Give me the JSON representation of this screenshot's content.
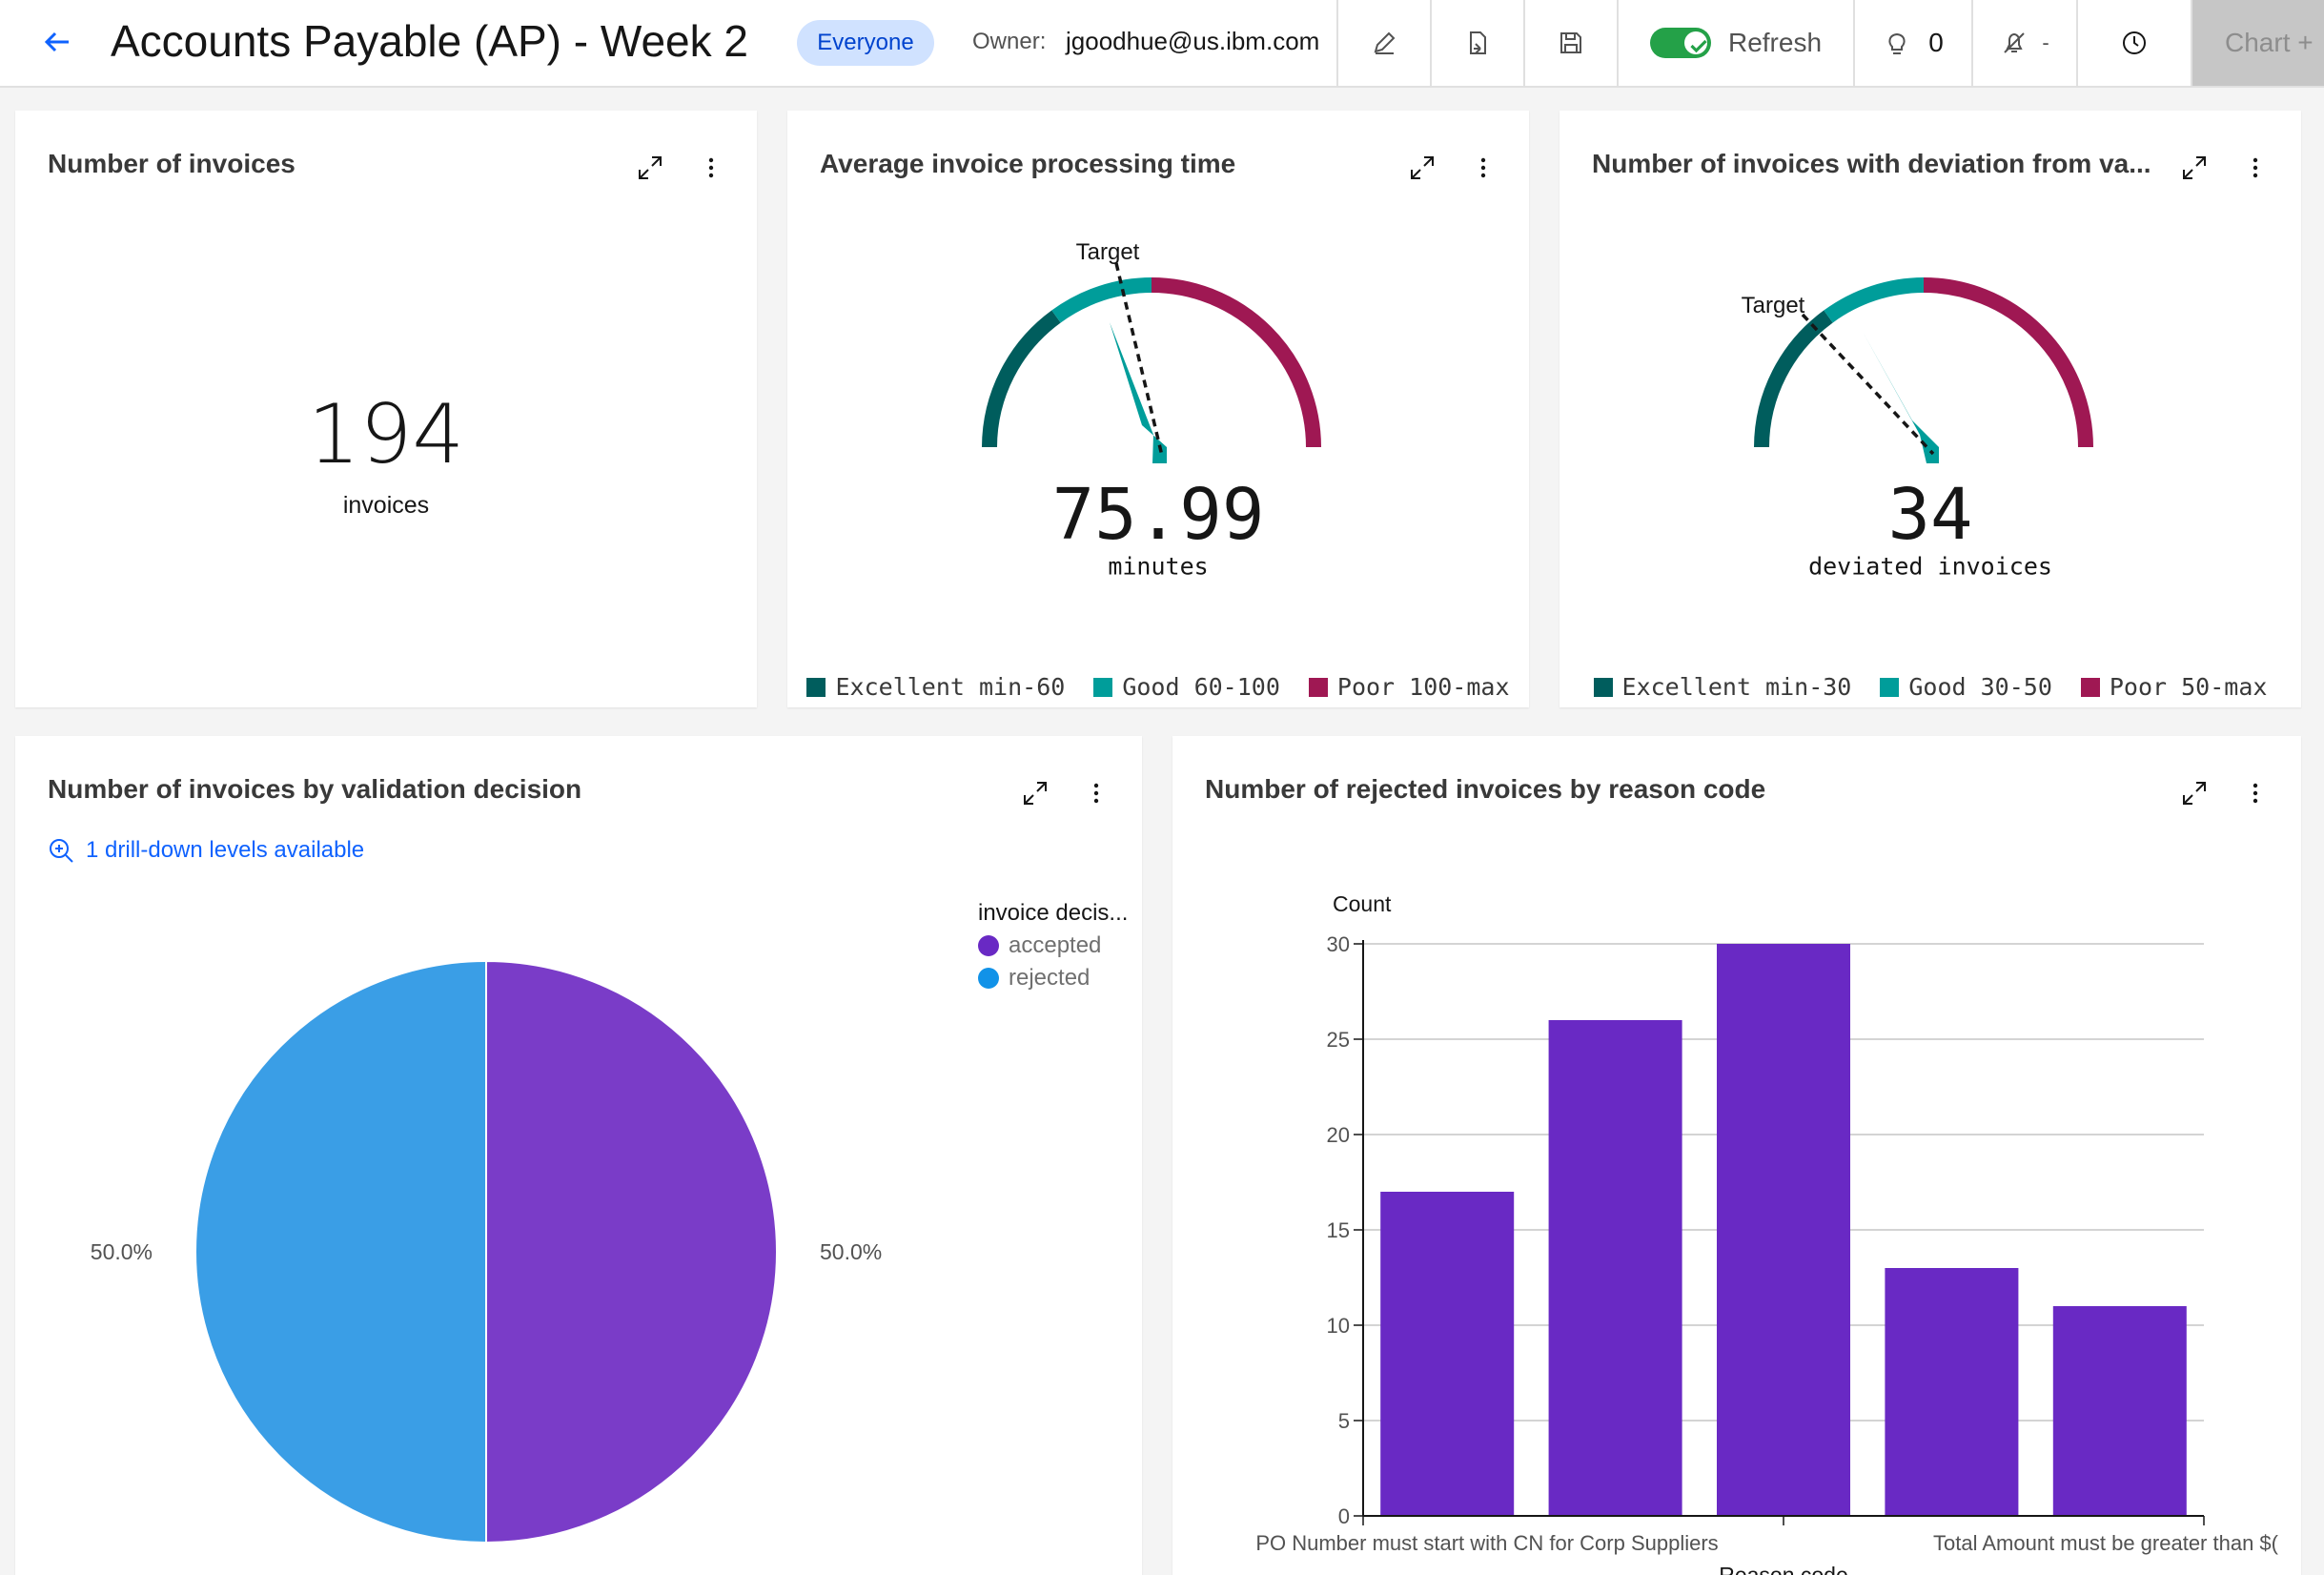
{
  "header": {
    "title": "Accounts Payable (AP) - Week 2",
    "sharing_badge": "Everyone",
    "owner_label": "Owner:",
    "owner_value": "jgoodhue@us.ibm.com",
    "refresh_label": "Refresh",
    "refresh_enabled": true,
    "insights_count": "0",
    "alerts_value": "-",
    "chart_add_label": "Chart +"
  },
  "cards": {
    "invoices": {
      "title": "Number of invoices",
      "value": "194",
      "unit": "invoices"
    },
    "processing_time": {
      "title": "Average invoice processing time",
      "value": "75.99",
      "unit": "minutes",
      "target_label": "Target",
      "gauge_value": 75.99,
      "target": 72,
      "scale": [
        0,
        160
      ],
      "legend": [
        {
          "label": "Excellent min-60",
          "color": "#005d5d"
        },
        {
          "label": "Good 60-100",
          "color": "#009d9a"
        },
        {
          "label": "Poor 100-max",
          "color": "#9f1853"
        }
      ]
    },
    "deviation": {
      "title": "Number of invoices with deviation from va...",
      "value": "34",
      "unit": "deviated invoices",
      "target_label": "Target",
      "gauge_value": 34,
      "target": 24,
      "scale": [
        0,
        80
      ],
      "legend": [
        {
          "label": "Excellent min-30",
          "color": "#005d5d"
        },
        {
          "label": "Good 30-50",
          "color": "#009d9a"
        },
        {
          "label": "Poor 50-max",
          "color": "#9f1853"
        }
      ]
    },
    "validation": {
      "title": "Number of invoices by validation decision",
      "drill_label": "1 drill-down levels available",
      "legend_title": "invoice decis...",
      "legend_items": [
        {
          "label": "accepted",
          "color": "#6929c4"
        },
        {
          "label": "rejected",
          "color": "#1192e8"
        }
      ]
    },
    "rejected": {
      "title": "Number of rejected invoices by reason code"
    }
  },
  "chart_data": [
    {
      "type": "pie",
      "categories": [
        "accepted",
        "rejected"
      ],
      "values": [
        50.0,
        50.0
      ],
      "labels": [
        "50.0%",
        "50.0%"
      ],
      "colors": [
        "#7a3cc8",
        "#3a9ee6"
      ]
    },
    {
      "type": "bar",
      "ylabel": "Count",
      "xlabel": "Reason code",
      "categories": [
        "PO Number must start with CN for Corp Suppliers",
        "",
        "",
        "Total Amount must be greater than $(",
        ""
      ],
      "values": [
        17,
        26,
        30,
        13,
        11
      ],
      "ylim": [
        0,
        30
      ],
      "yticks": [
        0,
        5,
        10,
        15,
        20,
        25,
        30
      ],
      "color": "#6929c4"
    }
  ]
}
